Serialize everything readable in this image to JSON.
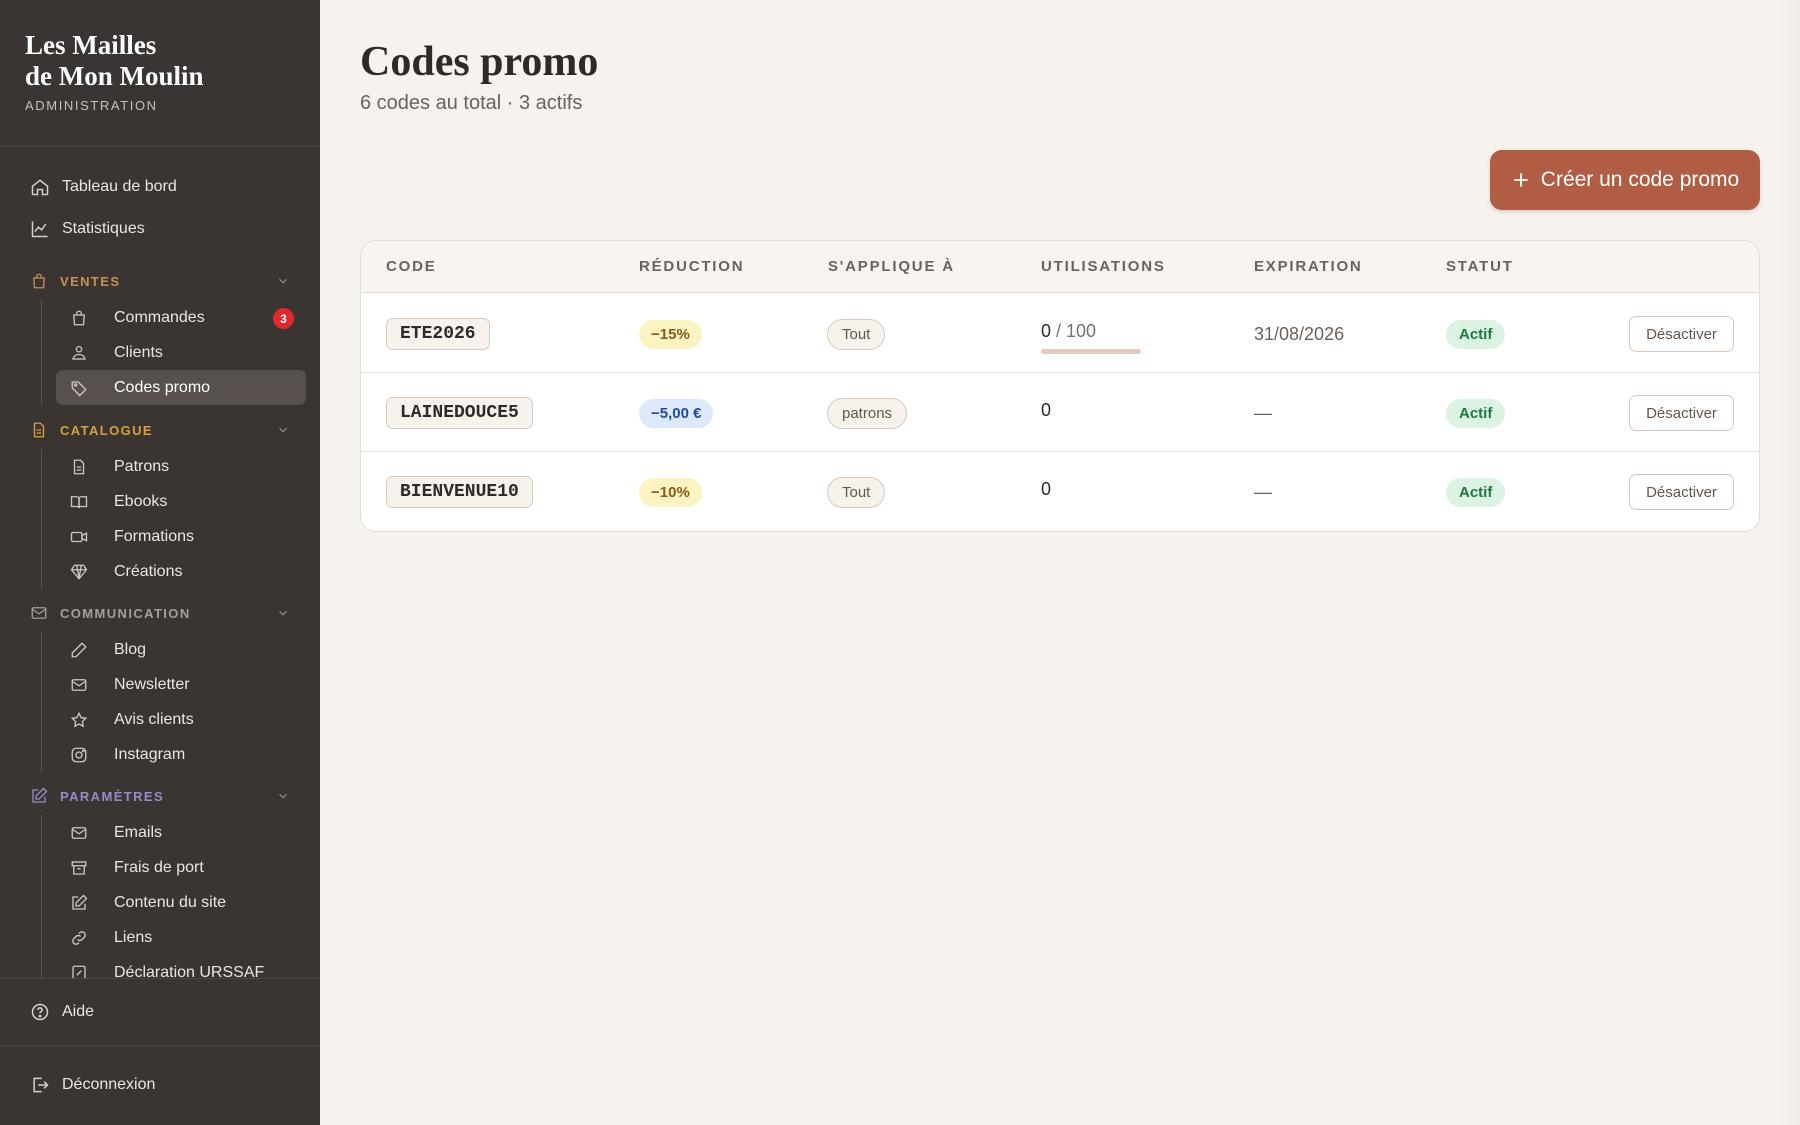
{
  "brand": {
    "title_line1": "Les Mailles",
    "title_line2": "de Mon Moulin",
    "subtitle": "ADMINISTRATION"
  },
  "nav": {
    "top": [
      {
        "label": "Tableau de bord",
        "icon": "home-icon"
      },
      {
        "label": "Statistiques",
        "icon": "chart-icon"
      }
    ],
    "sections": [
      {
        "label": "VENTES",
        "color": "#c99052",
        "icon": "bag-icon",
        "items": [
          {
            "label": "Commandes",
            "icon": "bag-icon",
            "badge": "3"
          },
          {
            "label": "Clients",
            "icon": "users-icon"
          },
          {
            "label": "Codes promo",
            "icon": "tag-icon",
            "active": true
          }
        ]
      },
      {
        "label": "CATALOGUE",
        "color": "#d4a23c",
        "icon": "file-icon",
        "items": [
          {
            "label": "Patrons",
            "icon": "file-icon"
          },
          {
            "label": "Ebooks",
            "icon": "book-icon"
          },
          {
            "label": "Formations",
            "icon": "video-icon"
          },
          {
            "label": "Créations",
            "icon": "diamond-icon"
          }
        ]
      },
      {
        "label": "COMMUNICATION",
        "color": "#a89d96",
        "icon": "mail-icon",
        "items": [
          {
            "label": "Blog",
            "icon": "pen-icon"
          },
          {
            "label": "Newsletter",
            "icon": "mail-icon"
          },
          {
            "label": "Avis clients",
            "icon": "star-icon"
          },
          {
            "label": "Instagram",
            "icon": "instagram-icon"
          }
        ]
      },
      {
        "label": "PARAMÈTRES",
        "color": "#9b8ac4",
        "icon": "edit-icon",
        "items": [
          {
            "label": "Emails",
            "icon": "mail-icon"
          },
          {
            "label": "Frais de port",
            "icon": "box-icon"
          },
          {
            "label": "Contenu du site",
            "icon": "edit-icon"
          },
          {
            "label": "Liens",
            "icon": "link-icon"
          },
          {
            "label": "Déclaration URSSAF",
            "icon": "doc-icon"
          }
        ]
      }
    ],
    "help": "Aide",
    "logout": "Déconnexion"
  },
  "page": {
    "title": "Codes promo",
    "subtitle": "6 codes au total · 3 actifs",
    "create_label": "Créer un code promo"
  },
  "table": {
    "headers": [
      "CODE",
      "RÉDUCTION",
      "S'APPLIQUE À",
      "UTILISATIONS",
      "EXPIRATION",
      "STATUT"
    ],
    "rows": [
      {
        "code": "ETE2026",
        "reduction": "−15%",
        "reduction_kind": "percent",
        "applies_to": "Tout",
        "uses": "0",
        "max_uses": "/ 100",
        "usage_fraction": 0,
        "expiration": "31/08/2026",
        "status": "Actif",
        "action": "Désactiver"
      },
      {
        "code": "LAINEDOUCE5",
        "reduction": "−5,00 €",
        "reduction_kind": "amount",
        "applies_to": "patrons",
        "uses": "0",
        "max_uses": "",
        "usage_fraction": null,
        "expiration": "—",
        "status": "Actif",
        "action": "Désactiver"
      },
      {
        "code": "BIENVENUE10",
        "reduction": "−10%",
        "reduction_kind": "percent",
        "applies_to": "Tout",
        "uses": "0",
        "max_uses": "",
        "usage_fraction": null,
        "expiration": "—",
        "status": "Actif",
        "action": "Désactiver"
      }
    ]
  },
  "colors": {
    "accent": "#b05d43",
    "sidebar": "#3a3533",
    "background": "#f6f3ee",
    "status_active": "#1b7a3e"
  }
}
